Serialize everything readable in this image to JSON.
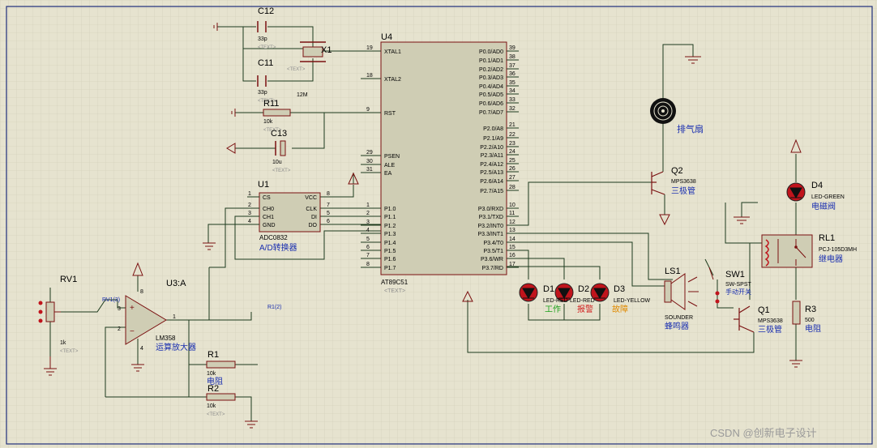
{
  "watermark": "CSDN @创新电子设计",
  "mcu": {
    "ref": "U4",
    "part": "AT89C51",
    "text_tag": "<TEXT>",
    "left_pins": [
      {
        "num": "19",
        "name": "XTAL1"
      },
      {
        "num": "18",
        "name": "XTAL2"
      },
      {
        "num": "9",
        "name": "RST"
      },
      {
        "num": "29",
        "name": "PSEN"
      },
      {
        "num": "30",
        "name": "ALE"
      },
      {
        "num": "31",
        "name": "EA"
      },
      {
        "num": "1",
        "name": "P1.0"
      },
      {
        "num": "2",
        "name": "P1.1"
      },
      {
        "num": "3",
        "name": "P1.2"
      },
      {
        "num": "4",
        "name": "P1.3"
      },
      {
        "num": "5",
        "name": "P1.4"
      },
      {
        "num": "6",
        "name": "P1.5"
      },
      {
        "num": "7",
        "name": "P1.6"
      },
      {
        "num": "8",
        "name": "P1.7"
      }
    ],
    "right_pins": [
      {
        "num": "39",
        "name": "P0.0/AD0"
      },
      {
        "num": "38",
        "name": "P0.1/AD1"
      },
      {
        "num": "37",
        "name": "P0.2/AD2"
      },
      {
        "num": "36",
        "name": "P0.3/AD3"
      },
      {
        "num": "35",
        "name": "P0.4/AD4"
      },
      {
        "num": "34",
        "name": "P0.5/AD5"
      },
      {
        "num": "33",
        "name": "P0.6/AD6"
      },
      {
        "num": "32",
        "name": "P0.7/AD7"
      },
      {
        "num": "21",
        "name": "P2.0/A8"
      },
      {
        "num": "22",
        "name": "P2.1/A9"
      },
      {
        "num": "23",
        "name": "P2.2/A10"
      },
      {
        "num": "24",
        "name": "P2.3/A11"
      },
      {
        "num": "25",
        "name": "P2.4/A12"
      },
      {
        "num": "26",
        "name": "P2.5/A13"
      },
      {
        "num": "27",
        "name": "P2.6/A14"
      },
      {
        "num": "28",
        "name": "P2.7/A15"
      },
      {
        "num": "10",
        "name": "P3.0/RXD"
      },
      {
        "num": "11",
        "name": "P3.1/TXD"
      },
      {
        "num": "12",
        "name": "P3.2/INT0"
      },
      {
        "num": "13",
        "name": "P3.3/INT1"
      },
      {
        "num": "14",
        "name": "P3.4/T0"
      },
      {
        "num": "15",
        "name": "P3.5/T1"
      },
      {
        "num": "16",
        "name": "P3.6/WR"
      },
      {
        "num": "17",
        "name": "P3.7/RD"
      }
    ]
  },
  "adc": {
    "ref": "U1",
    "part": "ADC0832",
    "desc": "A/D转换器",
    "left_pins": [
      {
        "num": "1",
        "name": "CS"
      },
      {
        "num": "2",
        "name": "CH0"
      },
      {
        "num": "3",
        "name": "CH1"
      },
      {
        "num": "4",
        "name": "GND"
      }
    ],
    "right_pins": [
      {
        "num": "8",
        "name": "VCC"
      },
      {
        "num": "7",
        "name": "CLK"
      },
      {
        "num": "5",
        "name": "DI"
      },
      {
        "num": "6",
        "name": "DO"
      }
    ]
  },
  "opamp": {
    "ref": "U3:A",
    "part": "LM358",
    "desc": "运算放大器",
    "pins": {
      "non_inverting": "3",
      "inverting": "2",
      "output": "1",
      "vcc": "8",
      "gnd": "4"
    }
  },
  "crystal": {
    "ref": "X1",
    "value": "12M"
  },
  "capacitors": [
    {
      "ref": "C12",
      "value": "33p",
      "text": "<TEXT>"
    },
    {
      "ref": "C11",
      "value": "33p",
      "text": "<TEXT>"
    },
    {
      "ref": "C13",
      "value": "10u",
      "text": "<TEXT>"
    }
  ],
  "crystal_text": "<TEXT>",
  "resistors": [
    {
      "ref": "R11",
      "value": "10k",
      "text": "<TEXT>"
    },
    {
      "ref": "R1",
      "value": "10k",
      "desc": "电阻",
      "text": "<TEXT>"
    },
    {
      "ref": "R2",
      "value": "10k",
      "text": "<TEXT>"
    },
    {
      "ref": "R3",
      "value": "500",
      "desc": "电阻"
    }
  ],
  "pot": {
    "ref": "RV1",
    "value": "1k",
    "probe": "RV1(3)",
    "text": "<TEXT>"
  },
  "probe_r1": "R1(2)",
  "fan": {
    "desc": "排气扇"
  },
  "transistors": [
    {
      "ref": "Q2",
      "part": "MPS3638",
      "desc": "三极管"
    },
    {
      "ref": "Q1",
      "part": "MPS3638",
      "desc": "三极管"
    }
  ],
  "leds": [
    {
      "ref": "D1",
      "part": "LED-RED",
      "desc": "工作",
      "desc_color": "#1aa01a"
    },
    {
      "ref": "D2",
      "part": "LED-RED",
      "desc": "报警",
      "desc_color": "#d02020"
    },
    {
      "ref": "D3",
      "part": "LED-YELLOW",
      "desc": "故障",
      "desc_color": "#e08a00"
    },
    {
      "ref": "D4",
      "part": "LED-GREEN",
      "desc": "电磁阀",
      "desc_color": "#1a2fb0"
    }
  ],
  "buzzer": {
    "ref": "LS1",
    "part": "SOUNDER",
    "desc": "蜂鸣器"
  },
  "switch": {
    "ref": "SW1",
    "part": "SW-SPST",
    "desc": "手动开关"
  },
  "relay": {
    "ref": "RL1",
    "part": "PCJ-105D3MH",
    "desc": "继电器"
  },
  "colors": {
    "background": "#e6e3cf",
    "grid": "#cfccb6",
    "border": "#1f2f7a",
    "wire": "#1c3a1c",
    "component": "#7a1010",
    "ic_fill": "#cfcdb4",
    "label_blue": "#1a2fb0",
    "led_red": "#c0141c"
  }
}
